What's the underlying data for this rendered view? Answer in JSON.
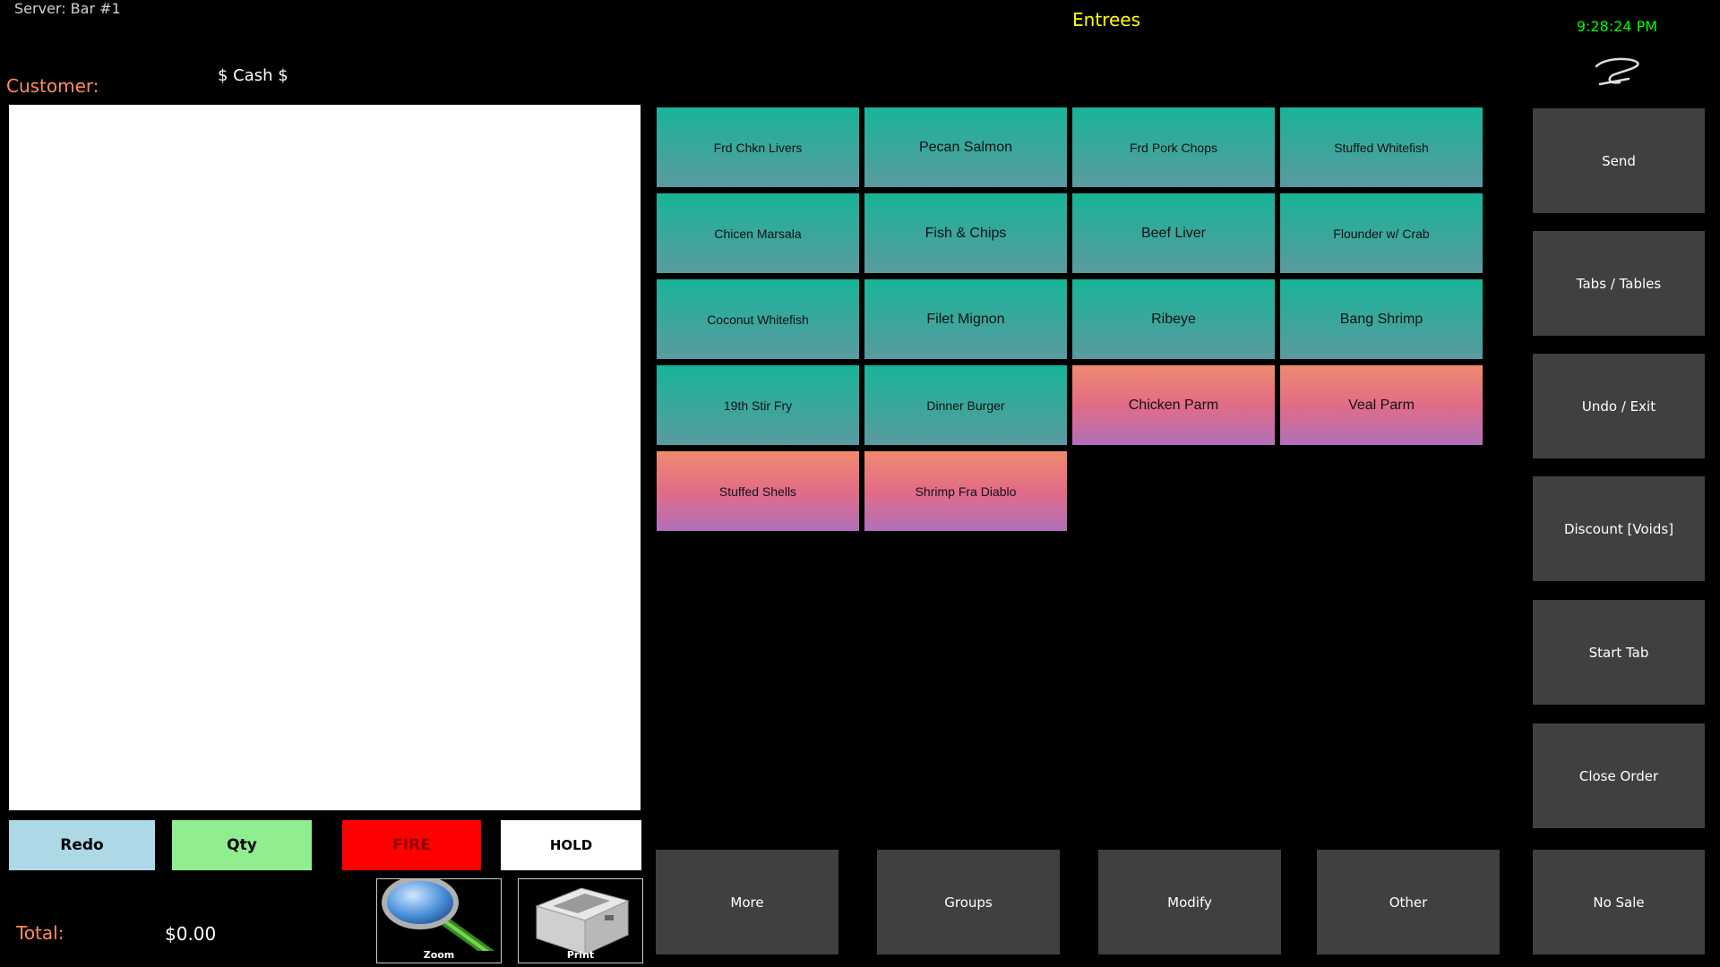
{
  "header": {
    "server": "Server: Bar #1",
    "category": "Entrees",
    "clock": "9:28:24 PM"
  },
  "customer": {
    "label": "Customer:",
    "payment": "$ Cash $"
  },
  "actions": {
    "redo": "Redo",
    "qty": "Qty",
    "fire": "FIRE",
    "hold": "HOLD"
  },
  "total": {
    "label": "Total:",
    "value": "$0.00"
  },
  "tools": {
    "zoom": "Zoom",
    "print": "Print"
  },
  "menu_items": [
    {
      "label": "Frd Chkn Livers",
      "color": "teal"
    },
    {
      "label": "Pecan Salmon",
      "color": "teal"
    },
    {
      "label": "Frd Pork Chops",
      "color": "teal"
    },
    {
      "label": "Stuffed Whitefish",
      "color": "teal"
    },
    {
      "label": "Chicen Marsala",
      "color": "teal"
    },
    {
      "label": "Fish & Chips",
      "color": "teal"
    },
    {
      "label": "Beef Liver",
      "color": "teal"
    },
    {
      "label": "Flounder w/ Crab",
      "color": "teal"
    },
    {
      "label": "Coconut Whitefish",
      "color": "teal"
    },
    {
      "label": "Filet Mignon",
      "color": "teal"
    },
    {
      "label": "Ribeye",
      "color": "teal"
    },
    {
      "label": "Bang Shrimp",
      "color": "teal"
    },
    {
      "label": "19th Stir Fry",
      "color": "teal"
    },
    {
      "label": "Dinner Burger",
      "color": "teal"
    },
    {
      "label": "Chicken Parm",
      "color": "pink"
    },
    {
      "label": "Veal Parm",
      "color": "pink"
    },
    {
      "label": "Stuffed Shells",
      "color": "pink"
    },
    {
      "label": "Shrimp Fra Diablo",
      "color": "pink"
    }
  ],
  "side_buttons": [
    "Send",
    "Tabs / Tables",
    "Undo / Exit",
    "Discount  [Voids]",
    "Start Tab",
    "Close Order"
  ],
  "bottom_buttons": [
    "More",
    "Groups",
    "Modify",
    "Other",
    "No Sale"
  ],
  "colors": {
    "teal_top": "#18b498",
    "pink_top": "#f08a6e",
    "button_gray": "#404040",
    "fire": "#ff0000",
    "qty": "#90ee90",
    "redo": "#add8e6"
  }
}
